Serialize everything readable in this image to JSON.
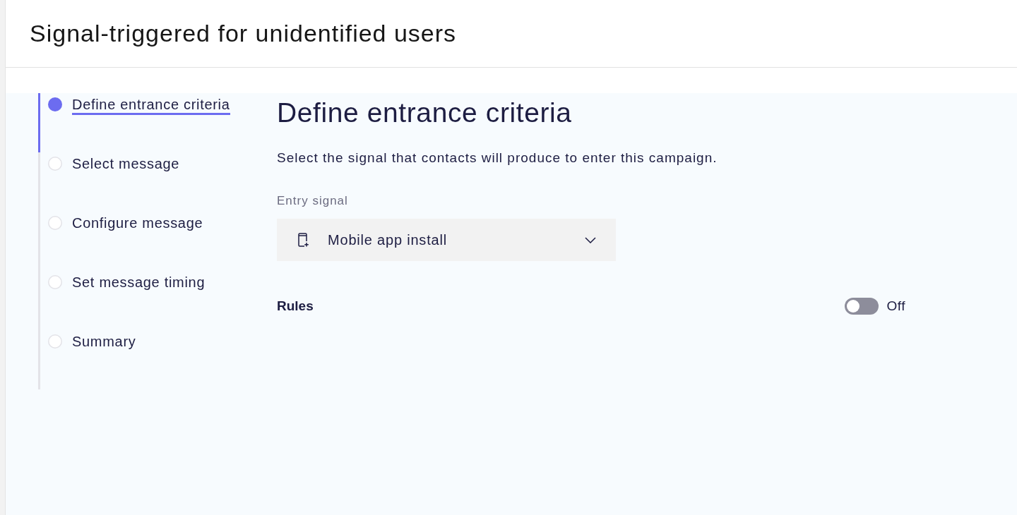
{
  "header": {
    "title": "Signal-triggered for unidentified users"
  },
  "steps": [
    {
      "label": "Define entrance criteria",
      "selected": true
    },
    {
      "label": "Select message",
      "selected": false
    },
    {
      "label": "Configure message",
      "selected": false
    },
    {
      "label": "Set message timing",
      "selected": false
    },
    {
      "label": "Summary",
      "selected": false
    }
  ],
  "content": {
    "title": "Define entrance criteria",
    "description": "Select the signal that contacts will produce to enter this campaign.",
    "entry_signal": {
      "label": "Entry signal",
      "value": "Mobile app install"
    },
    "rules": {
      "label": "Rules",
      "on": false,
      "state_label": "Off"
    }
  }
}
